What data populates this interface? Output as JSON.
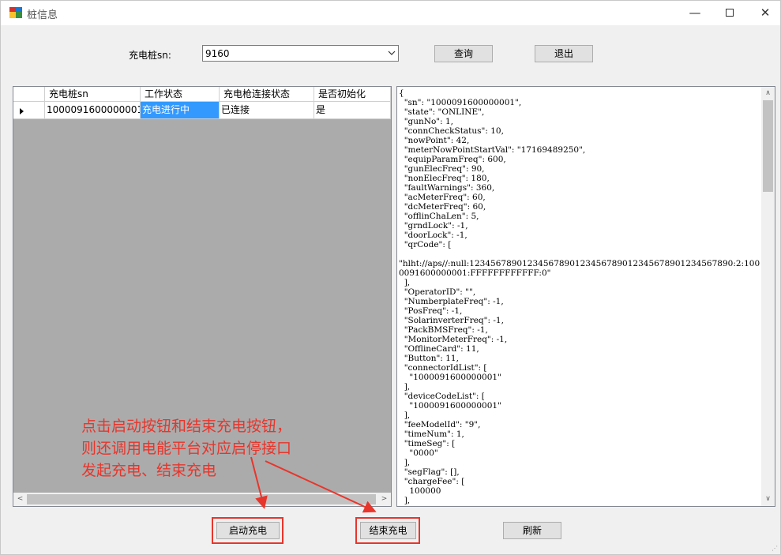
{
  "window": {
    "title": "桩信息"
  },
  "form": {
    "sn_label": "充电桩sn:",
    "sn_value": "9160",
    "query_button": "查询",
    "exit_button": "退出",
    "start_button": "启动充电",
    "end_button": "结束充电",
    "refresh_button": "刷新"
  },
  "grid": {
    "columns": [
      "充电桩sn",
      "工作状态",
      "充电枪连接状态",
      "是否初始化"
    ],
    "rows": [
      {
        "sn": "1000091600000001",
        "status": "充电进行中",
        "connection": "已连接",
        "initialized": "是"
      }
    ]
  },
  "json_text": "{\n  \"sn\": \"1000091600000001\",\n  \"state\": \"ONLINE\",\n  \"gunNo\": 1,\n  \"connCheckStatus\": 10,\n  \"nowPoint\": 42,\n  \"meterNowPointStartVal\": \"17169489250\",\n  \"equipParamFreq\": 600,\n  \"gunElecFreq\": 90,\n  \"nonElecFreq\": 180,\n  \"faultWarnings\": 360,\n  \"acMeterFreq\": 60,\n  \"dcMeterFreq\": 60,\n  \"offlinChaLen\": 5,\n  \"grndLock\": -1,\n  \"doorLock\": -1,\n  \"qrCode\": [\n\n\"hlht://aps//:null:12345678901234567890123456789012345678901234567890:2:1000091600000001:FFFFFFFFFFFF:0\"\n  ],\n  \"OperatorID\": \"\",\n  \"NumberplateFreq\": -1,\n  \"PosFreq\": -1,\n  \"SolarinverterFreq\": -1,\n  \"PackBMSFreq\": -1,\n  \"MonitorMeterFreq\": -1,\n  \"OfflineCard\": 11,\n  \"Button\": 11,\n  \"connectorIdList\": [\n    \"1000091600000001\"\n  ],\n  \"deviceCodeList\": [\n    \"1000091600000001\"\n  ],\n  \"feeModelId\": \"9\",\n  \"timeNum\": 1,\n  \"timeSeg\": [\n    \"0000\"\n  ],\n  \"segFlag\": [],\n  \"chargeFee\": [\n    100000\n  ],",
  "annotation": {
    "lines": [
      "点击启动按钮和结束充电按钮，",
      "则还调用电能平台对应启停接口",
      "发起充电、结束充电"
    ],
    "color": "#e8352b"
  },
  "icons": [
    "app-icon",
    "minimize-icon",
    "maximize-icon",
    "close-icon",
    "chevron-down-icon",
    "row-pointer-icon",
    "scroll-left-icon",
    "scroll-right-icon",
    "scroll-up-icon",
    "scroll-down-icon"
  ]
}
